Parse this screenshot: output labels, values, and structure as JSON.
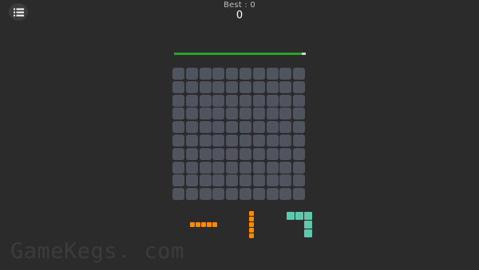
{
  "header": {
    "best_label": "Best : 0",
    "score": "0",
    "menu_icon": "list-icon"
  },
  "timer": {
    "progress": 0.97,
    "color": "#2aa12a",
    "track_color": "#cfd3d6"
  },
  "board": {
    "rows": 10,
    "columns": 10,
    "empty_cell_color": "#50545f"
  },
  "pieces": [
    {
      "name": "horizontal-line-5",
      "color": "#ff8a00",
      "cells": [
        [
          0,
          0
        ],
        [
          1,
          0
        ],
        [
          2,
          0
        ],
        [
          3,
          0
        ],
        [
          4,
          0
        ]
      ]
    },
    {
      "name": "vertical-line-5",
      "color": "#ff8a00",
      "cells": [
        [
          0,
          0
        ],
        [
          0,
          1
        ],
        [
          0,
          2
        ],
        [
          0,
          3
        ],
        [
          0,
          4
        ]
      ]
    },
    {
      "name": "corner-piece",
      "color": "#5ec8ad",
      "cells": [
        [
          0,
          0
        ],
        [
          1,
          0
        ],
        [
          2,
          0
        ],
        [
          2,
          1
        ],
        [
          2,
          2
        ]
      ]
    }
  ],
  "watermark": "GameKegs. com"
}
